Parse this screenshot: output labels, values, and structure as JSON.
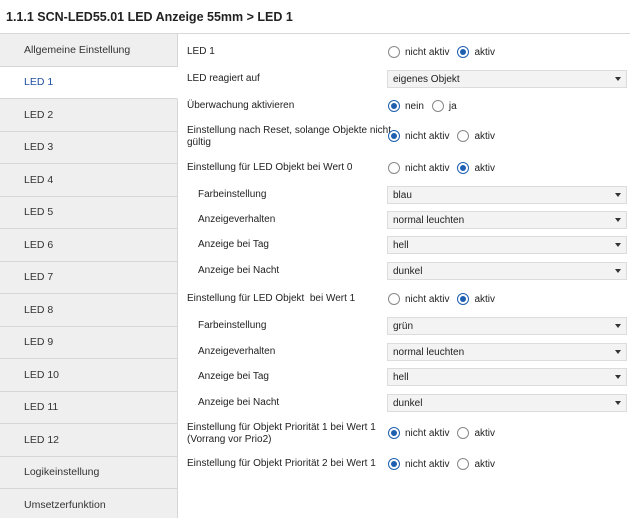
{
  "window": {
    "title": "1.1.1 SCN-LED55.01 LED Anzeige 55mm > LED 1"
  },
  "sidebar": {
    "items": [
      {
        "label": "Allgemeine Einstellung",
        "active": false
      },
      {
        "label": "LED 1",
        "active": true
      },
      {
        "label": "LED 2",
        "active": false
      },
      {
        "label": "LED 3",
        "active": false
      },
      {
        "label": "LED 4",
        "active": false
      },
      {
        "label": "LED 5",
        "active": false
      },
      {
        "label": "LED 6",
        "active": false
      },
      {
        "label": "LED 7",
        "active": false
      },
      {
        "label": "LED 8",
        "active": false
      },
      {
        "label": "LED 9",
        "active": false
      },
      {
        "label": "LED 10",
        "active": false
      },
      {
        "label": "LED 11",
        "active": false
      },
      {
        "label": "LED 12",
        "active": false
      },
      {
        "label": "Logikeinstellung",
        "active": false
      },
      {
        "label": "Umsetzerfunktion",
        "active": false
      }
    ]
  },
  "main": {
    "led1": {
      "label": "LED 1",
      "opt1": "nicht aktiv",
      "opt2": "aktiv",
      "selected": "aktiv"
    },
    "reagiert": {
      "label": "LED reagiert auf",
      "value": "eigenes Objekt"
    },
    "ueberwachung": {
      "label": "Überwachung aktivieren",
      "opt1": "nein",
      "opt2": "ja",
      "selected": "nein"
    },
    "reset": {
      "label_line1": "Einstellung nach Reset, solange Objekte nicht",
      "label_line2": "gültig",
      "opt1": "nicht aktiv",
      "opt2": "aktiv",
      "selected": "nicht aktiv"
    },
    "wert0": {
      "label": "Einstellung für LED Objekt bei Wert 0",
      "opt1": "nicht aktiv",
      "opt2": "aktiv",
      "selected": "aktiv",
      "farb_label": "Farbeinstellung",
      "farb_value": "blau",
      "verhalten_label": "Anzeigeverhalten",
      "verhalten_value": "normal leuchten",
      "tag_label": "Anzeige bei Tag",
      "tag_value": "hell",
      "nacht_label": "Anzeige bei Nacht",
      "nacht_value": "dunkel"
    },
    "wert1": {
      "label": "Einstellung für LED Objekt  bei Wert 1",
      "opt1": "nicht aktiv",
      "opt2": "aktiv",
      "selected": "aktiv",
      "farb_label": "Farbeinstellung",
      "farb_value": "grün",
      "verhalten_label": "Anzeigeverhalten",
      "verhalten_value": "normal leuchten",
      "tag_label": "Anzeige bei Tag",
      "tag_value": "hell",
      "nacht_label": "Anzeige bei Nacht",
      "nacht_value": "dunkel"
    },
    "prio1": {
      "label_line1": "Einstellung für Objekt Priorität 1 bei Wert 1",
      "label_line2": "(Vorrang vor Prio2)",
      "opt1": "nicht aktiv",
      "opt2": "aktiv",
      "selected": "nicht aktiv"
    },
    "prio2": {
      "label": "Einstellung für Objekt Priorität 2 bei Wert 1",
      "opt1": "nicht aktiv",
      "opt2": "aktiv",
      "selected": "nicht aktiv"
    }
  },
  "colors": {
    "accent": "#1f5fb0",
    "sidebar_bg": "#efefef",
    "active_text": "#1f4fa3"
  }
}
